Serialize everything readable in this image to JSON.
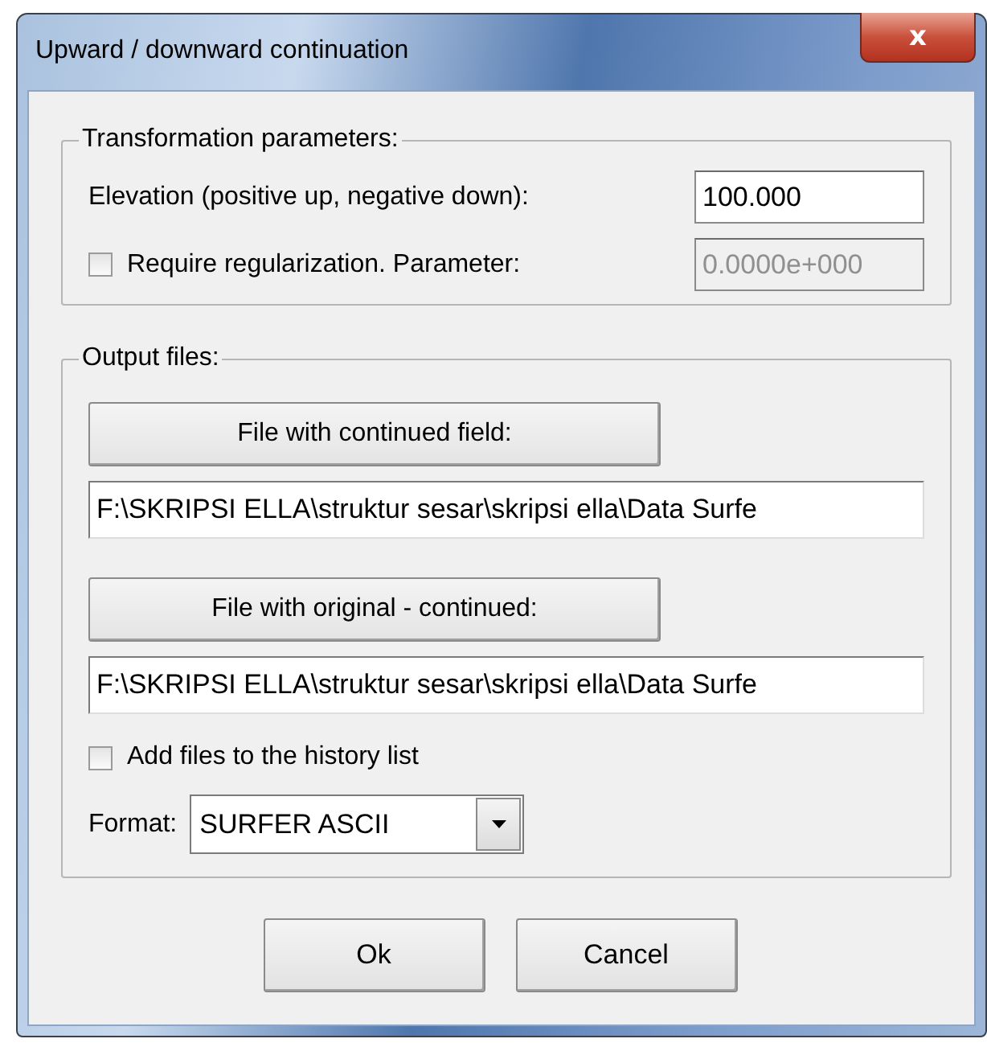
{
  "window": {
    "title": "Upward / downward  continuation",
    "close_label": "x"
  },
  "transformation": {
    "legend": "Transformation parameters:",
    "elevation_label": "Elevation (positive up, negative down):",
    "elevation_value": "100.000",
    "regularization": {
      "label": "Require regularization. Parameter:",
      "checked": false
    },
    "parameter": {
      "value": "0.0000e+000",
      "disabled": true
    }
  },
  "output": {
    "legend": "Output files:",
    "files": [
      {
        "button": "File with continued field:",
        "path": "F:\\SKRIPSI ELLA\\struktur sesar\\skripsi ella\\Data Surfe"
      },
      {
        "button": "File with original - continued:",
        "path": "F:\\SKRIPSI ELLA\\struktur sesar\\skripsi ella\\Data Surfe"
      }
    ],
    "history": {
      "label": "Add files to the history list",
      "checked": false
    },
    "format_label": "Format:",
    "format_value": "SURFER ASCII"
  },
  "buttons": [
    "Ok",
    "Cancel"
  ]
}
